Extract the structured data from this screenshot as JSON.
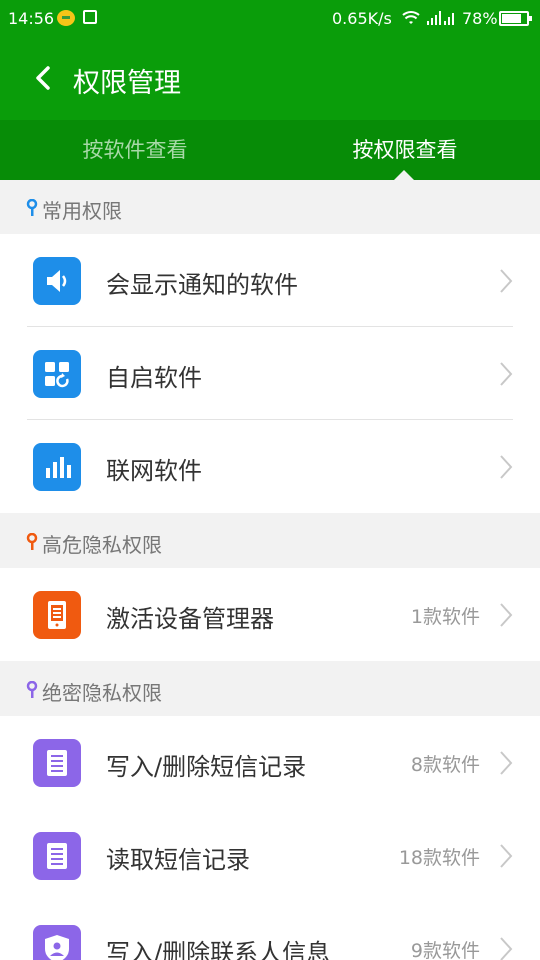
{
  "status_bar": {
    "time": "14:56",
    "net_speed": "0.65K/s",
    "battery": "78%",
    "battery_level": 0.78,
    "icons": [
      "wifi-icon",
      "signal-icon",
      "battery-icon"
    ]
  },
  "header": {
    "title": "权限管理",
    "back_icon": "chevron-left-icon"
  },
  "tabs": [
    {
      "label": "按软件查看",
      "active": false
    },
    {
      "label": "按权限查看",
      "active": true
    }
  ],
  "sections": [
    {
      "title": "常用权限",
      "pin_color": "#1e8ee9",
      "items": [
        {
          "label": "会显示通知的软件",
          "count": "",
          "icon": "speaker-icon",
          "color": "#1e8ee9"
        },
        {
          "label": "自启软件",
          "count": "",
          "icon": "app-grid-refresh-icon",
          "color": "#1e8ee9"
        },
        {
          "label": "联网软件",
          "count": "",
          "icon": "bar-chart-icon",
          "color": "#1e8ee9"
        }
      ]
    },
    {
      "title": "高危隐私权限",
      "pin_color": "#f05a10",
      "items": [
        {
          "label": "激活设备管理器",
          "count": "1款软件",
          "icon": "device-admin-icon",
          "color": "#f05a10"
        }
      ]
    },
    {
      "title": "绝密隐私权限",
      "pin_color": "#8c66e8",
      "items": [
        {
          "label": "写入/删除短信记录",
          "count": "8款软件",
          "icon": "document-icon",
          "color": "#8c66e8"
        },
        {
          "label": "读取短信记录",
          "count": "18款软件",
          "icon": "document-icon",
          "color": "#8c66e8"
        },
        {
          "label": "写入/删除联系人信息",
          "count": "9款软件",
          "icon": "contact-shield-icon",
          "color": "#8c66e8"
        }
      ]
    }
  ]
}
